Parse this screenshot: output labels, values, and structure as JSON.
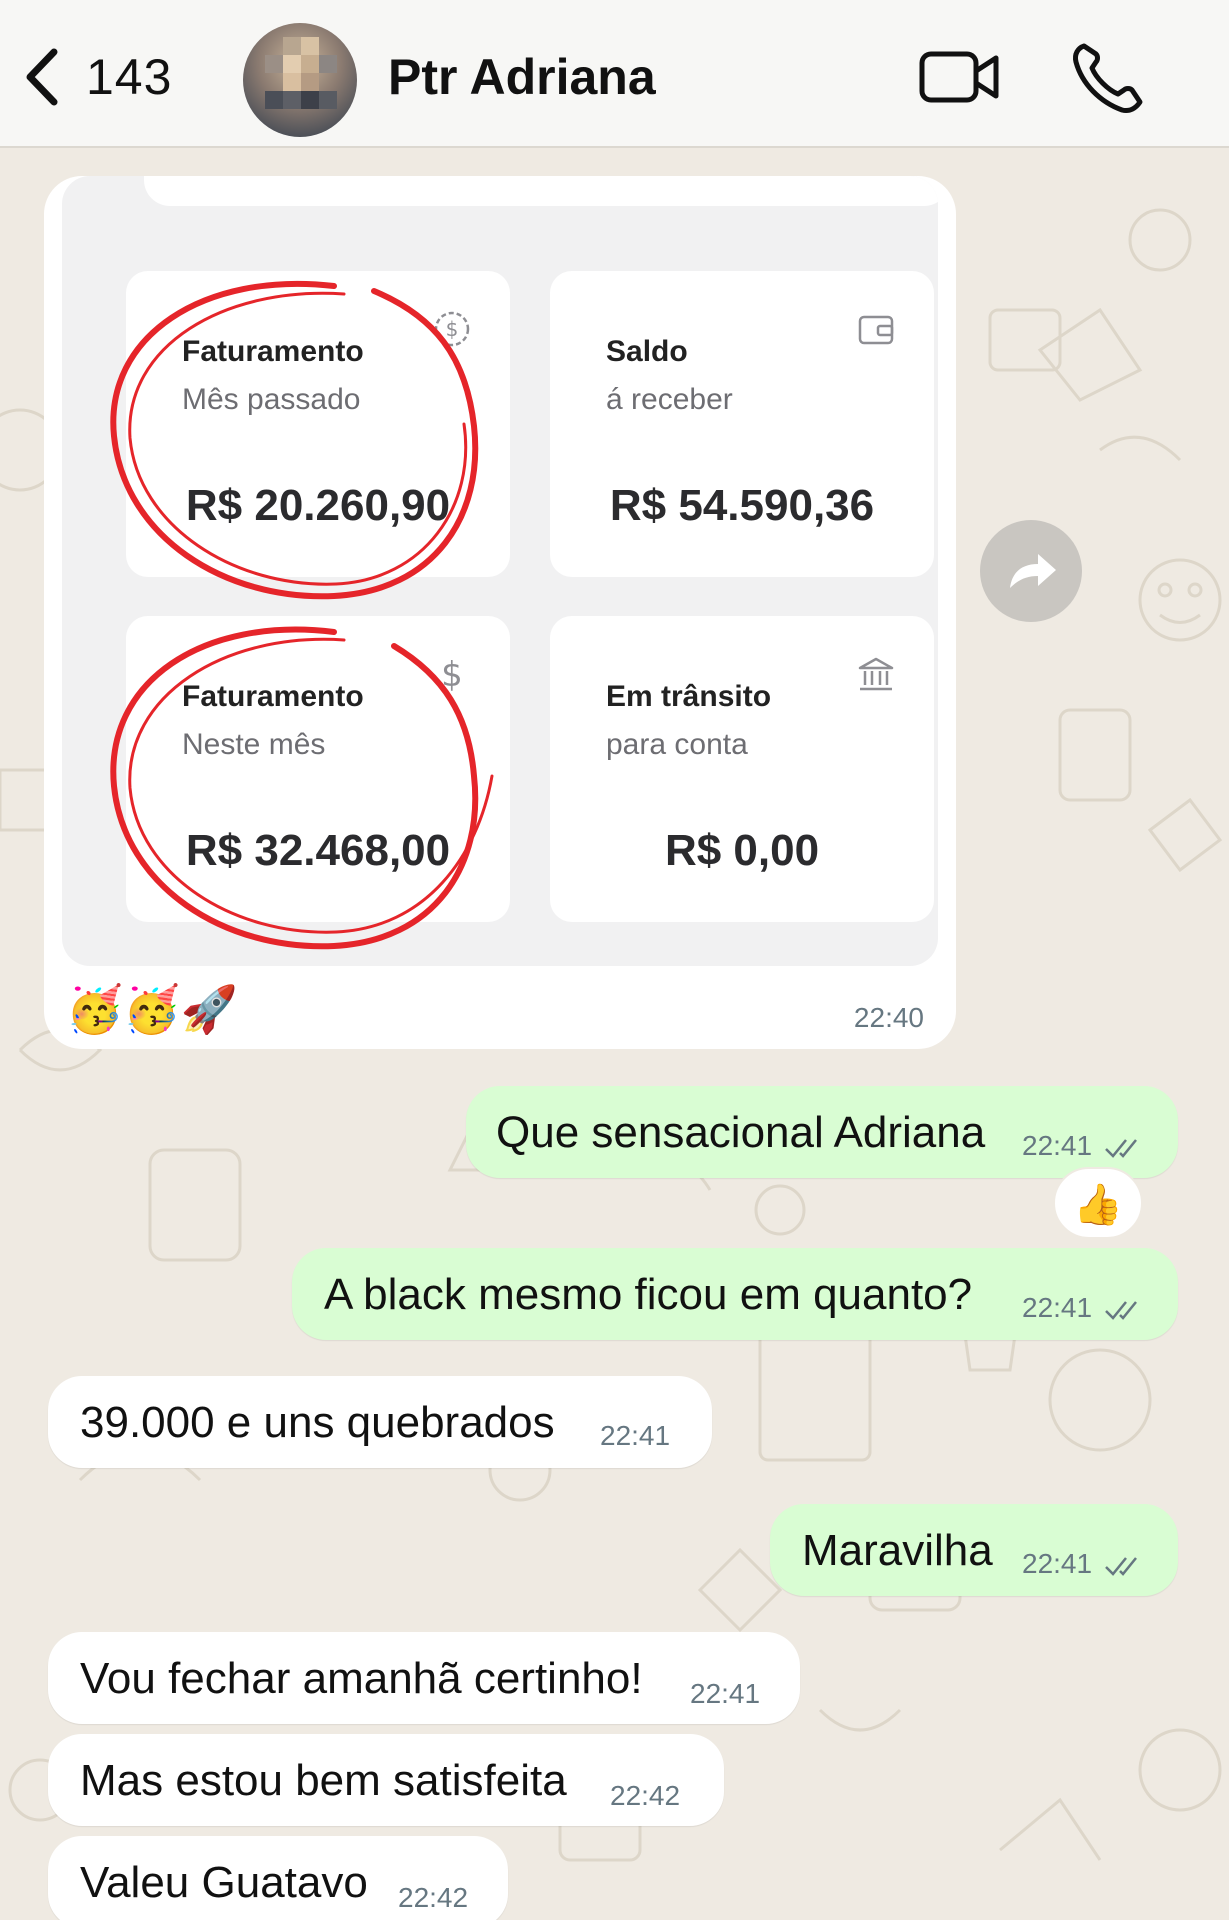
{
  "header": {
    "back_count": "143",
    "contact_name": "Ptr Adriana"
  },
  "image_message": {
    "cards": [
      {
        "title": "Faturamento",
        "subtitle": "Mês passado",
        "value": "R$ 20.260,90",
        "icon": "dollar-coin-icon",
        "circled": true
      },
      {
        "title": "Saldo",
        "subtitle": "á receber",
        "value": "R$ 54.590,36",
        "icon": "wallet-icon",
        "circled": false
      },
      {
        "title": "Faturamento",
        "subtitle": "Neste mês",
        "value": "R$ 32.468,00",
        "icon": "dollar-sign-icon",
        "circled": true
      },
      {
        "title": "Em trânsito",
        "subtitle": "para conta",
        "value": "R$ 0,00",
        "icon": "bank-icon",
        "circled": false
      }
    ],
    "caption_emojis": "🥳🥳🚀",
    "time": "22:40"
  },
  "messages": [
    {
      "direction": "out",
      "text": "Que sensacional Adriana",
      "time": "22:41",
      "read": true,
      "reaction": "👍"
    },
    {
      "direction": "out",
      "text": "A black mesmo ficou em quanto?",
      "time": "22:41",
      "read": true
    },
    {
      "direction": "in",
      "text": "39.000 e uns quebrados",
      "time": "22:41"
    },
    {
      "direction": "out",
      "text": "Maravilha",
      "time": "22:41",
      "read": true
    },
    {
      "direction": "in",
      "text": "Vou fechar amanhã certinho!",
      "time": "22:41"
    },
    {
      "direction": "in",
      "text": "Mas estou bem satisfeita",
      "time": "22:42"
    },
    {
      "direction": "in",
      "text": "Valeu Guatavo",
      "time": "22:42"
    }
  ],
  "colors": {
    "chat_background": "#efeae2",
    "outgoing_bubble": "#d9fdd3",
    "incoming_bubble": "#ffffff",
    "highlight_circle": "#e5252a",
    "read_ticks": "#667781"
  }
}
